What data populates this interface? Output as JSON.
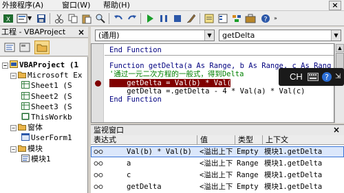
{
  "menubar": {
    "items": [
      "外接程序(A)",
      "窗口(W)",
      "帮助(H)"
    ]
  },
  "toolbar": {
    "icons": [
      "view-excel-icon",
      "insert-module-icon",
      "save-icon",
      "cut-icon",
      "copy-icon",
      "paste-icon",
      "find-icon",
      "undo-icon",
      "redo-icon",
      "run-icon",
      "break-icon",
      "reset-icon",
      "design-mode-icon",
      "project-explorer-icon",
      "properties-icon",
      "object-browser-icon",
      "toolbox-icon",
      "help-icon"
    ]
  },
  "project": {
    "title": "工程 - VBAProject",
    "close": "×",
    "tree": [
      {
        "text": "VBAProject (1",
        "pm": "−",
        "indent": 0,
        "icon": "project",
        "bold": true
      },
      {
        "text": "Microsoft Ex",
        "pm": "−",
        "indent": 1,
        "icon": "folder"
      },
      {
        "text": "Sheet1 (S",
        "pm": "",
        "indent": 2,
        "icon": "sheet"
      },
      {
        "text": "Sheet2 (S",
        "pm": "",
        "indent": 2,
        "icon": "sheet"
      },
      {
        "text": "Sheet3 (S",
        "pm": "",
        "indent": 2,
        "icon": "sheet"
      },
      {
        "text": "ThisWorkb",
        "pm": "",
        "indent": 2,
        "icon": "workbook"
      },
      {
        "text": "窗体",
        "pm": "−",
        "indent": 1,
        "icon": "folder"
      },
      {
        "text": "UserForm1",
        "pm": "",
        "indent": 2,
        "icon": "form"
      },
      {
        "text": "模块",
        "pm": "−",
        "indent": 1,
        "icon": "folder"
      },
      {
        "text": "模块1",
        "pm": "",
        "indent": 2,
        "icon": "module"
      }
    ]
  },
  "code": {
    "object_combo": "(通用)",
    "proc_combo": "getDelta",
    "lines": [
      {
        "text": "End Function",
        "kind": "keyword"
      },
      {
        "text": "",
        "kind": "divider"
      },
      {
        "text": "Function getDelta(a As Range, b As Range, c As Rang",
        "kind": "keyword"
      },
      {
        "text": "'通过一元二次方程的一般式，得到Delta",
        "kind": "comment"
      },
      {
        "text": "    getDelta = Val(b) * Val(b)",
        "kind": "breakpoint"
      },
      {
        "text": "    getDelta =.getDelta - 4 * Val(a) * Val(c)",
        "kind": "normal"
      },
      {
        "text": "End Function",
        "kind": "keyword"
      }
    ]
  },
  "watch": {
    "title": "监视窗口",
    "close": "×",
    "columns": [
      "表达式",
      "值",
      "类型",
      "上下文"
    ],
    "rows": [
      {
        "expr": "Val(b) * Val(b)",
        "value": "<溢出上下",
        "type": "Empty",
        "context": "模块1.getDelta",
        "selected": true
      },
      {
        "expr": "a",
        "value": "<溢出上下",
        "type": "Range",
        "context": "模块1.getDelta",
        "selected": false
      },
      {
        "expr": "c",
        "value": "<溢出上下",
        "type": "Range",
        "context": "模块1.getDelta",
        "selected": false
      },
      {
        "expr": "getDelta",
        "value": "<溢出上下",
        "type": "Empty",
        "context": "模块1.getDelta",
        "selected": false
      }
    ]
  },
  "ime": {
    "label": "CH"
  },
  "colors": {
    "breakpoint_bg": "#800000",
    "breakpoint_fg": "#ffffff",
    "keyword": "#000080",
    "comment": "#008000",
    "selection": "#3875d7"
  }
}
